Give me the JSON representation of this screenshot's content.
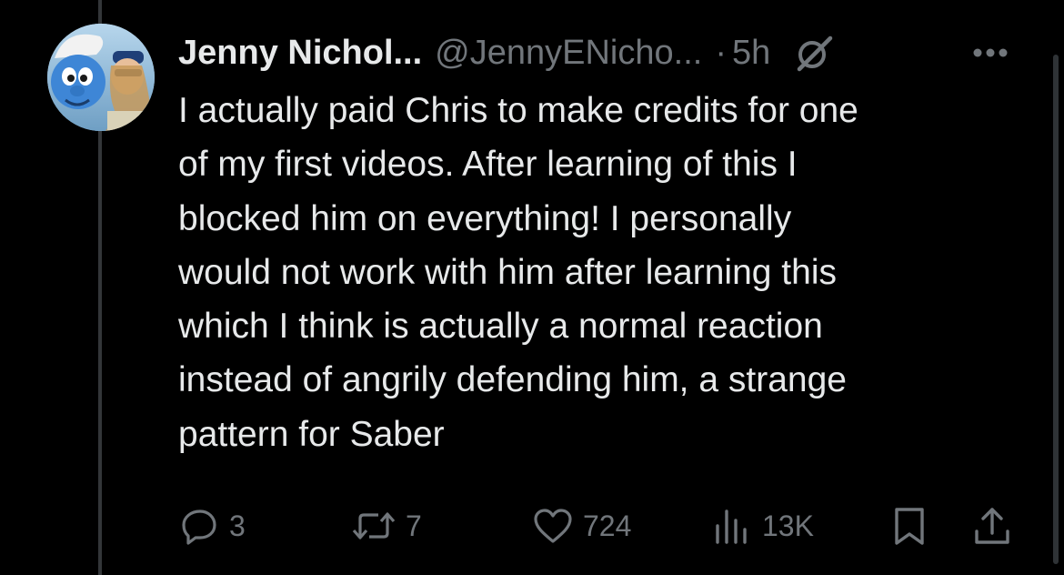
{
  "tweet": {
    "author_name": "Jenny Nichol...",
    "author_handle": "@JennyENicho...",
    "separator": "·",
    "time_ago": "5h",
    "text_lines": [
      "I actually paid Chris to make credits for one",
      "of my first videos. After learning of this I",
      "blocked him on everything! I personally",
      "would not work with him after learning this",
      "which I think is actually a normal reaction",
      "instead of angrily defending him, a strange",
      "pattern for Saber"
    ]
  },
  "metrics": {
    "replies": "3",
    "reposts": "7",
    "likes": "724",
    "views": "13K"
  },
  "icons": {
    "grok": "grok-icon",
    "more": "more-options-icon",
    "reply": "reply-icon",
    "repost": "repost-icon",
    "like": "heart-icon",
    "views": "views-chart-icon",
    "bookmark": "bookmark-icon",
    "share": "share-icon"
  },
  "colors": {
    "background": "#000000",
    "text_primary": "#e7e9ea",
    "text_secondary": "#71767b",
    "thread_line": "#333639"
  }
}
